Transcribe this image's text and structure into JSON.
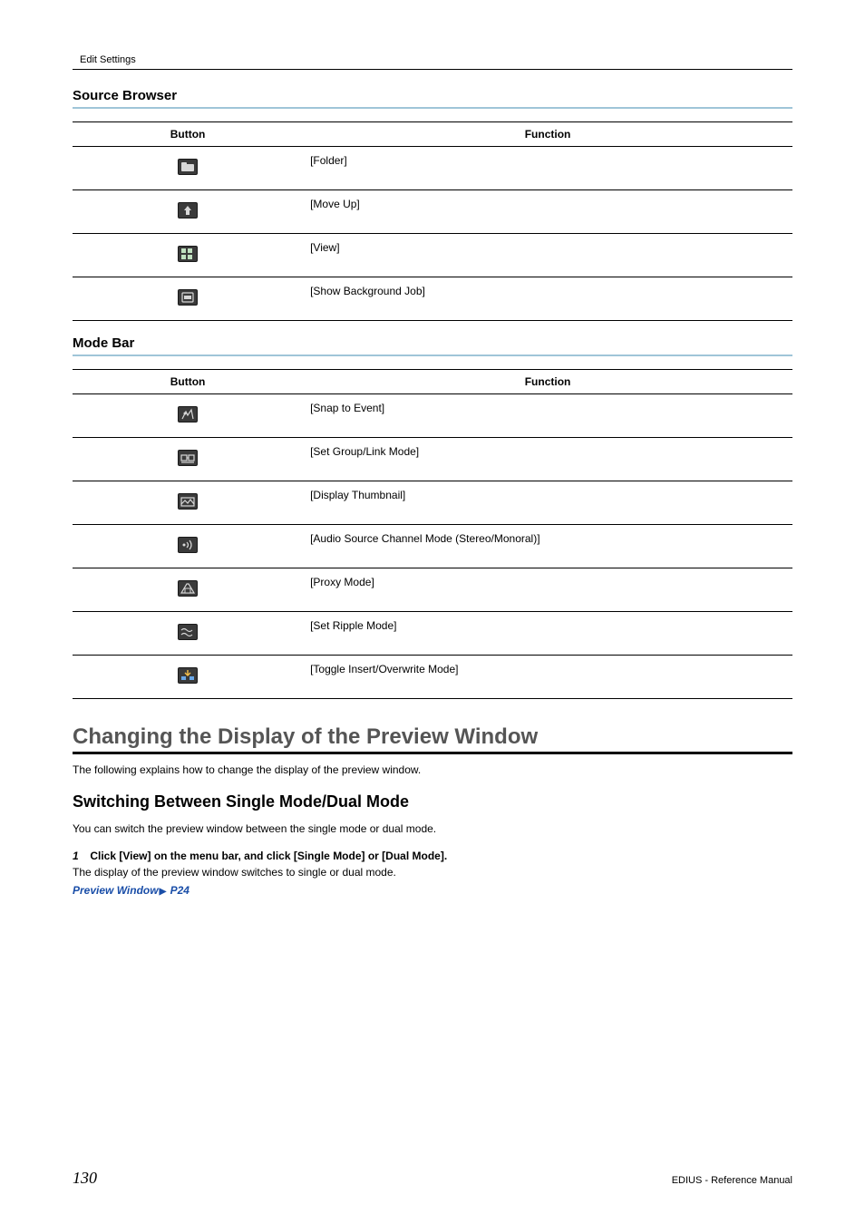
{
  "header": {
    "breadcrumb": "Edit Settings"
  },
  "sections": {
    "source_browser": {
      "title": "Source Browser",
      "cols": {
        "button": "Button",
        "function": "Function"
      },
      "rows": [
        {
          "icon": "folder-icon",
          "func": "[Folder]"
        },
        {
          "icon": "move-up-icon",
          "func": "[Move Up]"
        },
        {
          "icon": "view-grid-icon",
          "func": "[View]"
        },
        {
          "icon": "bg-job-icon",
          "func": "[Show Background Job]"
        }
      ]
    },
    "mode_bar": {
      "title": "Mode Bar",
      "cols": {
        "button": "Button",
        "function": "Function"
      },
      "rows": [
        {
          "icon": "snap-icon",
          "func": "[Snap to Event]"
        },
        {
          "icon": "group-link-icon",
          "func": "[Set Group/Link Mode]"
        },
        {
          "icon": "thumbnail-icon",
          "func": "[Display Thumbnail]"
        },
        {
          "icon": "audio-ch-icon",
          "func": "[Audio Source Channel Mode (Stereo/Monoral)]"
        },
        {
          "icon": "proxy-icon",
          "func": "[Proxy Mode]"
        },
        {
          "icon": "ripple-icon",
          "func": "[Set Ripple Mode]"
        },
        {
          "icon": "insert-ow-icon",
          "func": "[Toggle Insert/Overwrite Mode]"
        }
      ]
    }
  },
  "h2": {
    "title": "Changing the Display of the Preview Window",
    "intro": "The following explains how to change the display of the preview window."
  },
  "h3": {
    "title": "Switching Between Single Mode/Dual Mode",
    "intro": "You can switch the preview window between the single mode or dual mode.",
    "step1_num": "1",
    "step1_text": "Click [View] on the menu bar, and click [Single Mode] or [Dual Mode].",
    "after": "The display of the preview window switches to single or dual mode.",
    "xref": "Preview Window",
    "xref_page": "P24"
  },
  "footer": {
    "page": "130",
    "doc": "EDIUS - Reference Manual"
  }
}
